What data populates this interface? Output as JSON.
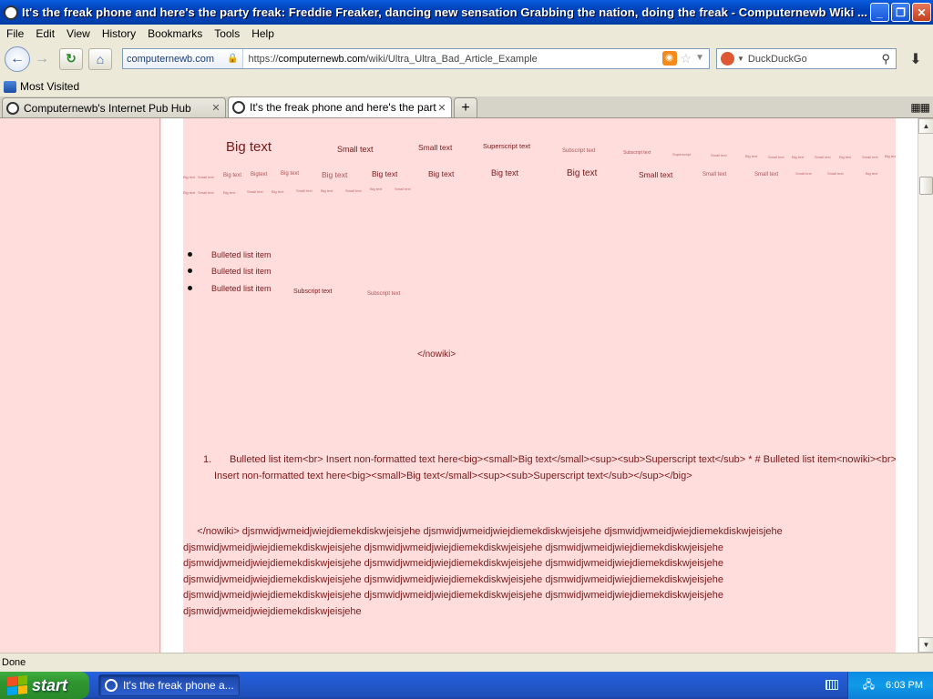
{
  "window": {
    "title": "It's the freak phone and here's the party freak: Freddie Freaker, dancing new sensation Grabbing the nation, doing the freak - Computernewb Wiki ...",
    "min_label": "_",
    "max_label": "❐",
    "close_label": "✕"
  },
  "menu": [
    "File",
    "Edit",
    "View",
    "History",
    "Bookmarks",
    "Tools",
    "Help"
  ],
  "nav": {
    "site_identity": "computernewb.com",
    "url_prefix": "https://",
    "url_domain": "computernewb.com",
    "url_path": "/wiki/Ultra_Ultra_Bad_Article_Example",
    "search_placeholder": "DuckDuckGo"
  },
  "bookmarks": {
    "most_visited": "Most Visited"
  },
  "tabs": [
    {
      "label": "Computernewb's Internet Pub Hub",
      "close": "✕"
    },
    {
      "label": "It's the freak phone and here's the party...",
      "close": "✕"
    }
  ],
  "newtab_label": "+",
  "article": {
    "row1": {
      "big": "Big text",
      "small": "Small text",
      "small2": "Small text",
      "superscript": "Superscript text",
      "subscript": "Subscript text",
      "subscript2": "Subscript text",
      "superscript2": "Superscript",
      "tiny": [
        "Small text",
        "Big text",
        "Small text",
        "Big text",
        "Small text",
        "Big text",
        "Small text",
        "Big text"
      ]
    },
    "row2": {
      "tiny_left": [
        "Big text",
        "Small text",
        "Big text",
        "Bigtext",
        "Big text"
      ],
      "big1": "Big text",
      "big2": "Big text",
      "big3": "Big text",
      "big4": "Big text",
      "big5": "Big text",
      "small1": "Small text",
      "small2": "Small text",
      "small3": "Small text",
      "tiny_right": [
        "Small text",
        "Small text",
        "Big text"
      ]
    },
    "row3_tiny": [
      "Big text",
      "Small text",
      "Big text",
      "Small text",
      "Big text",
      "Small text",
      "Big text",
      "Small text",
      "Big text",
      "Small text"
    ],
    "bullets": [
      "Bulleted list item",
      "Bulleted list item",
      "Bulleted list item"
    ],
    "subscript_a": "Subscript text",
    "subscript_b": "Subscript text",
    "nowiki_close": "</nowiki>",
    "numbered": {
      "number": "1.",
      "line1": "Bulleted list item<br> Insert non-formatted text here<big><small>Big text</small><sup><sub>Superscript text</sub> * # Bulleted list item<nowiki><br>",
      "line2": "Insert non-formatted text here<big><small>Big text</small><sup><sub>Superscript text</sub></sup></big>"
    },
    "paragraph": [
      "     </nowiki> djsmwidjwmeidjwiejdiemekdiskwjeisjehe djsmwidjwmeidjwiejdiemekdiskwjeisjehe djsmwidjwmeidjwiejdiemekdiskwjeisjehe",
      "djsmwidjwmeidjwiejdiemekdiskwjeisjehe djsmwidjwmeidjwiejdiemekdiskwjeisjehe djsmwidjwmeidjwiejdiemekdiskwjeisjehe",
      "djsmwidjwmeidjwiejdiemekdiskwjeisjehe djsmwidjwmeidjwiejdiemekdiskwjeisjehe djsmwidjwmeidjwiejdiemekdiskwjeisjehe",
      "djsmwidjwmeidjwiejdiemekdiskwjeisjehe djsmwidjwmeidjwiejdiemekdiskwjeisjehe djsmwidjwmeidjwiejdiemekdiskwjeisjehe",
      "djsmwidjwmeidjwiejdiemekdiskwjeisjehe djsmwidjwmeidjwiejdiemekdiskwjeisjehe djsmwidjwmeidjwiejdiemekdiskwjeisjehe",
      "djsmwidjwmeidjwiejdiemekdiskwjeisjehe"
    ]
  },
  "status": "Done",
  "taskbar": {
    "start": "start",
    "item": "It's the freak phone a...",
    "clock": "6:03 PM"
  },
  "colors": {
    "page_bg": "#ffdddd",
    "text": "#7a1818",
    "titlebar": "#0a5ddf",
    "taskbar": "#245edb",
    "start": "#3fae3f"
  }
}
